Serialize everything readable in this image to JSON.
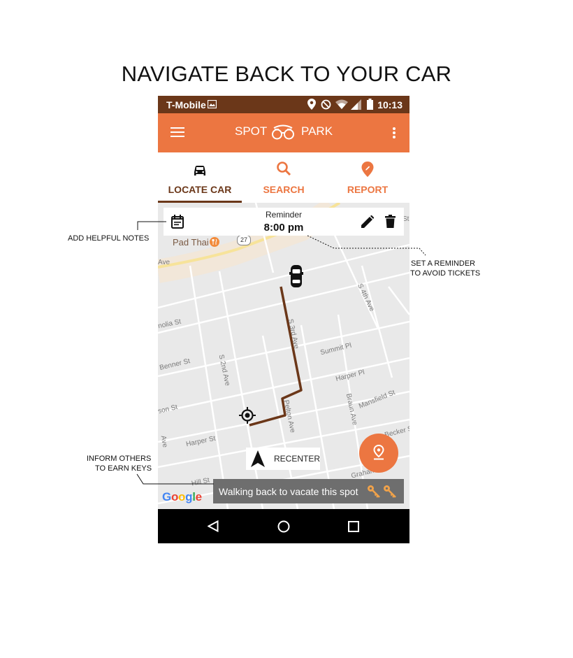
{
  "page_title": "NAVIGATE BACK TO YOUR CAR",
  "status_bar": {
    "carrier": "T-Mobile",
    "time": "10:13"
  },
  "app_bar": {
    "brand_left": "SPOT",
    "brand_right": "PARK"
  },
  "tabs": [
    {
      "label": "LOCATE CAR",
      "icon": "car-icon",
      "active": true
    },
    {
      "label": "SEARCH",
      "icon": "search-icon",
      "active": false
    },
    {
      "label": "REPORT",
      "icon": "report-pin-icon",
      "active": false
    }
  ],
  "reminder": {
    "label": "Reminder",
    "time": "8:00 pm"
  },
  "map": {
    "place": "Pad Thai",
    "route_marker": "27",
    "streets": [
      "Ave",
      "nolia St",
      "Benner St",
      "S 2nd Ave",
      "S 3rd Ave",
      "Summit Pl",
      "Harper Pl",
      "Braun Ave",
      "Mansfield St",
      "son St",
      "Pelton Ave",
      "Becker St",
      "Harper St",
      "Hill St",
      "Graham St",
      "S 4th Ave",
      "St",
      "Ave"
    ]
  },
  "recenter_label": "RECENTER",
  "walk_banner": "Walking back to vacate this spot",
  "google_logo": [
    "G",
    "o",
    "o",
    "g",
    "l",
    "e"
  ],
  "annotations": {
    "notes": "ADD HELPFUL NOTES",
    "reminder_line1": "SET A REMINDER",
    "reminder_line2": "TO AVOID TICKETS",
    "inform_line1": "INFORM OTHERS",
    "inform_line2": "TO EARN KEYS"
  },
  "colors": {
    "status_bar": "#6b3719",
    "app_bar": "#ec7641",
    "accent": "#ec7641",
    "route": "#6b3719",
    "active_tab": "#6b3719",
    "key": "#f0a24a"
  }
}
